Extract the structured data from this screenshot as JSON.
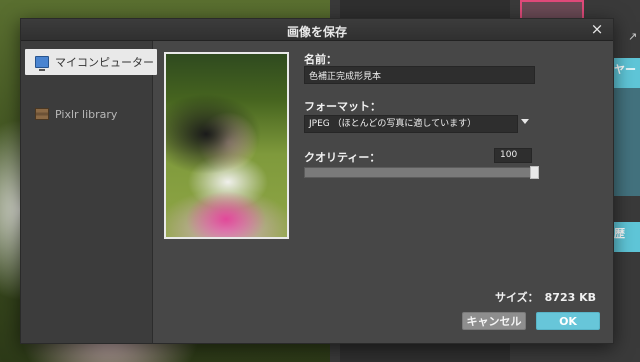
{
  "dialog": {
    "title": "画像を保存",
    "close_glyph": "×"
  },
  "sidebar": {
    "items": [
      {
        "label": "マイコンピューター",
        "icon": "monitor-icon",
        "active": true
      },
      {
        "label": "Pixlr library",
        "icon": "library-icon",
        "active": false
      }
    ]
  },
  "form": {
    "name_label": "名前：",
    "name_value": "色補正完成形見本",
    "format_label": "フォーマット：",
    "format_value": "JPEG （ほとんどの写真に適しています）",
    "quality_label": "クオリティー：",
    "quality_value": "100",
    "quality_level_percent": 100
  },
  "size": {
    "label": "サイズ：",
    "value": "8723 KB"
  },
  "buttons": {
    "cancel": "キャンセル",
    "ok": "OK"
  },
  "background": {
    "tab_labels": [
      "ヤー",
      "歴"
    ]
  },
  "colors": {
    "accent": "#67c6d9",
    "dialog_bg": "#474747",
    "sidebar_bg": "#3c3c3c"
  }
}
